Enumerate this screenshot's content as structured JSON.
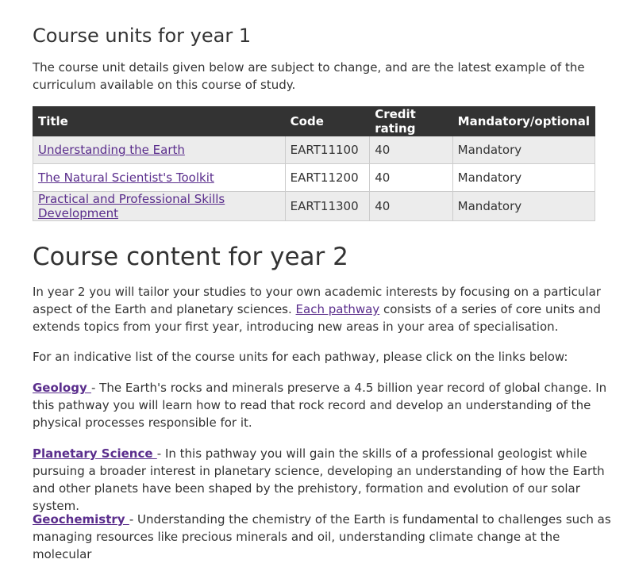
{
  "year1": {
    "heading": "Course units for year 1",
    "intro": "The course unit details given below are subject to change, and are the latest example of the curriculum available on this course of study.",
    "table": {
      "headers": [
        "Title",
        "Code",
        "Credit rating",
        "Mandatory/optional"
      ],
      "rows": [
        {
          "title": "Understanding the Earth",
          "code": "EART11100",
          "credit": "40",
          "status": "Mandatory"
        },
        {
          "title": "The Natural Scientist's Toolkit",
          "code": "EART11200",
          "credit": "40",
          "status": "Mandatory"
        },
        {
          "title": "Practical and Professional Skills Development",
          "code": "EART11300",
          "credit": "40",
          "status": "Mandatory"
        }
      ]
    }
  },
  "year2": {
    "heading": "Course content for year 2",
    "intro_before_link": "In year 2 you will tailor your studies to your own academic interests by focusing on a particular aspect of the Earth and planetary sciences.  ",
    "intro_link": "Each pathway",
    "intro_after_link": "  consists of a series of core units and extends topics from your first year, introducing new areas in your area of specialisation.",
    "list_intro": "For an indicative list of the course units for each pathway, please click on the links below:",
    "pathways": [
      {
        "name": "Geology ",
        "desc": "- The Earth's rocks and minerals preserve a 4.5 billion year record of global change. In this pathway you will learn how to read that rock record and develop an understanding of the physical processes responsible for it."
      },
      {
        "name": "Planetary Science ",
        "desc": "-  In this pathway you will gain the skills of a professional geologist while pursuing a broader interest in planetary science, developing an understanding of how the Earth and other planets have been shaped by the prehistory, formation and evolution of our solar system."
      },
      {
        "name": "Geochemistry ",
        "desc": "- Understanding the chemistry of the Earth is fundamental to challenges such as managing resources like precious minerals and oil, understanding climate change at the molecular"
      }
    ]
  },
  "colors": {
    "link": "#5a2d8c",
    "table_header_bg": "#333333",
    "row_shade": "#ececec",
    "text": "#333333"
  }
}
